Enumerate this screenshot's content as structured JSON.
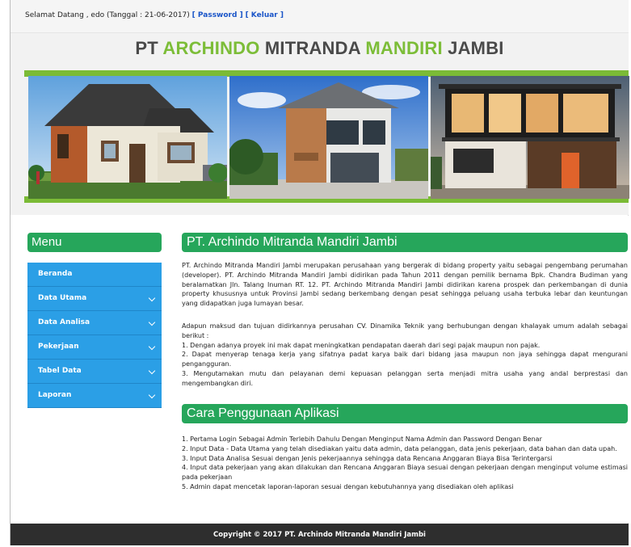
{
  "topbar": {
    "welcome_text": "Selamat Datang , edo (Tanggal : 21-06-2017)",
    "password_link": "[ Password ]",
    "logout_link": "[ Keluar ]"
  },
  "header": {
    "title_part1": "PT ",
    "title_part2": "ARCHINDO",
    "title_part3": " MITRANDA ",
    "title_part4": "MANDIRI",
    "title_part5": " JAMBI",
    "accent_color": "#7cbd38"
  },
  "menu": {
    "heading": "Menu",
    "items": [
      {
        "label": "Beranda",
        "has_submenu": false
      },
      {
        "label": "Data Utama",
        "has_submenu": true
      },
      {
        "label": "Data Analisa",
        "has_submenu": true
      },
      {
        "label": "Pekerjaan",
        "has_submenu": true
      },
      {
        "label": "Tabel Data",
        "has_submenu": true
      },
      {
        "label": "Laporan",
        "has_submenu": true
      }
    ]
  },
  "about": {
    "heading": "PT. Archindo Mitranda Mandiri Jambi",
    "paragraph1": "PT. Archindo Mitranda Mandiri Jambi merupakan perusahaan yang bergerak di bidang property yaitu sebagai pengembang perumahan (developer). PT. Archindo Mitranda Mandiri Jambi didirikan pada Tahun 2011 dengan pemilik bernama Bpk. Chandra Budiman yang beralamatkan Jln. Talang Inuman RT. 12. PT. Archindo Mitranda Mandiri Jambi didirikan karena prospek dan perkembangan di dunia property khususnya untuk Provinsi Jambi sedang berkembang dengan pesat sehingga peluang usaha terbuka lebar dan keuntungan yang didapatkan juga lumayan besar.",
    "paragraph2_intro": "Adapun maksud dan tujuan didirkannya perusahan CV. Dinamika Teknik yang berhubungan dengan khalayak umum adalah sebagai berikut :",
    "points": [
      "1. Dengan adanya proyek ini mak dapat meningkatkan pendapatan daerah dari segi pajak maupun non pajak.",
      "2. Dapat menyerap tenaga kerja yang sifatnya padat karya baik dari bidang jasa maupun non jaya sehingga dapat mengurani pengangguran.",
      "3. Mengutamakan mutu dan pelayanan demi kepuasan pelanggan serta menjadi mitra usaha yang andal berprestasi dan mengembangkan diri."
    ]
  },
  "usage": {
    "heading": "Cara Penggunaan Aplikasi",
    "steps": [
      "1. Pertama Login Sebagai Admin Terlebih Dahulu Dengan Menginput Nama Admin dan Password Dengan Benar",
      "2. Input Data - Data Utama yang telah disediakan yaitu data admin, data pelanggan, data jenis pekerjaan, data bahan dan data upah.",
      "3. Input Data Analisa Sesuai dengan Jenis pekerjaannya sehingga data Rencana Anggaran Biaya Bisa Terintergarsi",
      "4. Input data pekerjaan yang akan dilakukan dan Rencana Anggaran Biaya sesuai dengan pekerjaan dengan menginput volume estimasi pada pekerjaan",
      "5. Admin dapat mencetak laporan-laporan sesuai dengan kebutuhannya yang disediakan oleh aplikasi"
    ]
  },
  "footer": {
    "text": "Copyright © 2017 PT. Archindo Mitranda Mandiri Jambi"
  },
  "colors": {
    "section_heading": "#26a65b",
    "menu_bg": "#2b9fe6",
    "footer_bg": "#2e2e2e",
    "link": "#1a55c8"
  }
}
